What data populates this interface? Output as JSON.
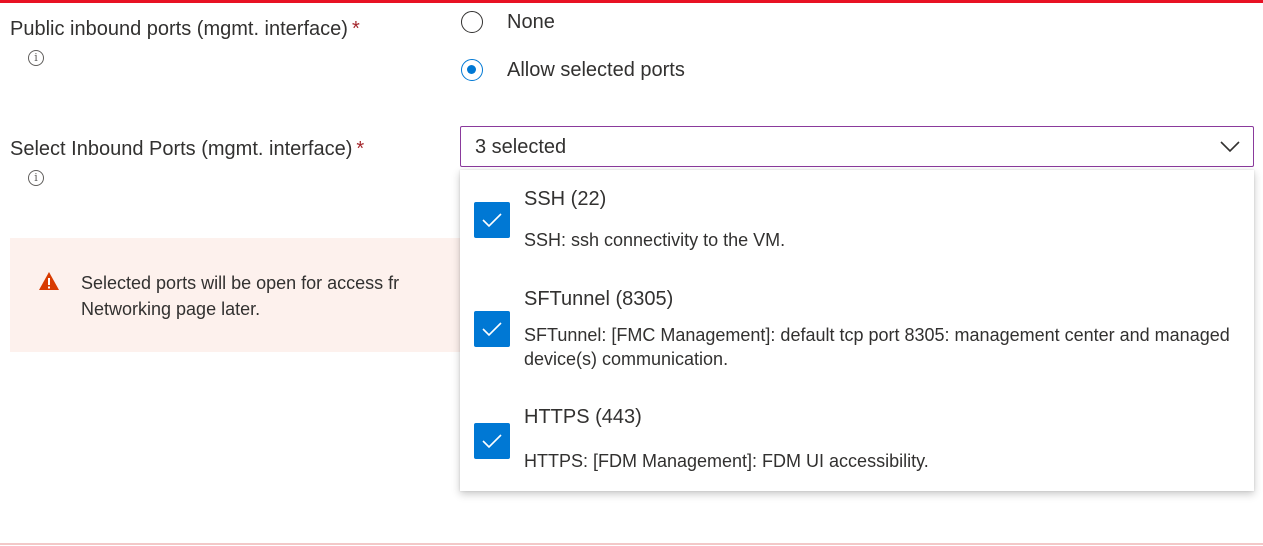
{
  "form": {
    "public_ports": {
      "label": "Public inbound ports (mgmt. interface)",
      "required": "*",
      "info": "i",
      "options": [
        {
          "label": "None",
          "selected": false
        },
        {
          "label": "Allow selected ports",
          "selected": true
        }
      ]
    },
    "select_ports": {
      "label": "Select Inbound Ports (mgmt. interface)",
      "required": "*",
      "info": "i",
      "value": "3 selected",
      "options": [
        {
          "title": "SSH (22)",
          "description": "SSH: ssh connectivity to the VM.",
          "checked": true
        },
        {
          "title": "SFTunnel (8305)",
          "description": "SFTunnel: [FMC Management]: default tcp port 8305: management center and managed device(s) communication.",
          "checked": true
        },
        {
          "title": "HTTPS (443)",
          "description": "HTTPS: [FDM Management]: FDM UI accessibility.",
          "checked": true
        }
      ]
    },
    "warning": {
      "line1": "Selected ports will be open for access fr",
      "line2": "Networking page later."
    }
  },
  "colors": {
    "accent": "#0078d4",
    "required": "#a4262c",
    "warning_bg": "#fdf1ed",
    "warning_icon": "#d83b01",
    "focus_border": "#8a3a9c"
  }
}
